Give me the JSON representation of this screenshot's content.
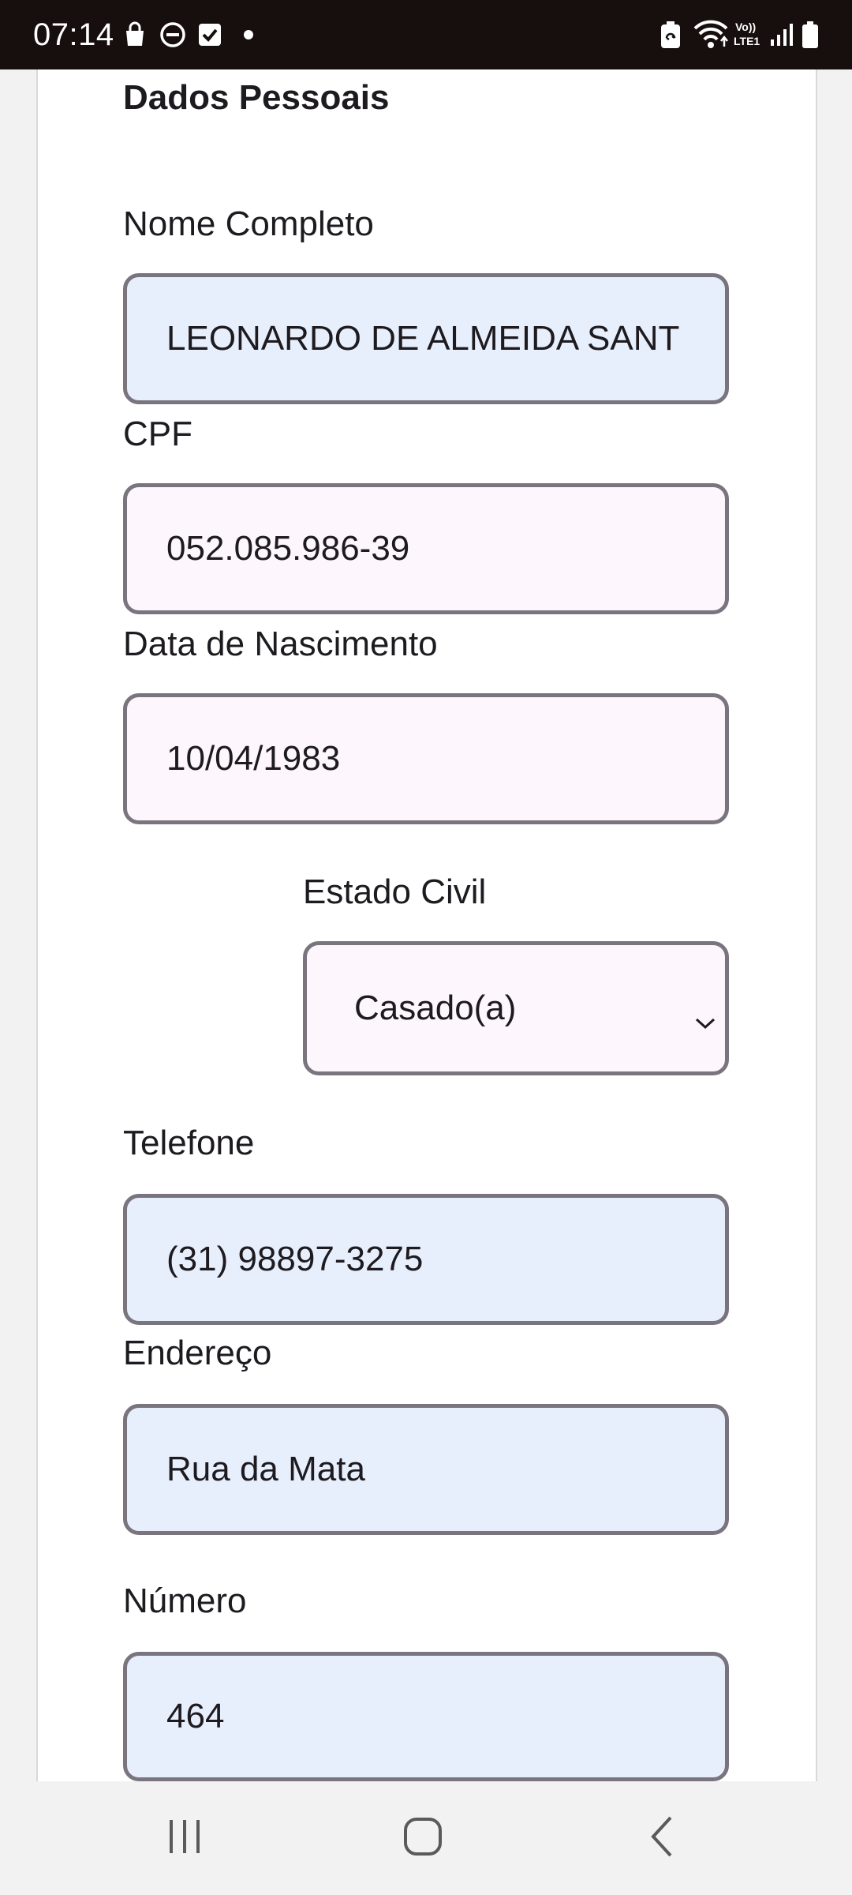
{
  "status_bar": {
    "time": "07:14",
    "left_icons": [
      "shopping-bag-icon",
      "do-not-disturb-icon",
      "checkbox-icon",
      "dot-icon"
    ],
    "right_icons": [
      "battery-saver-icon",
      "wifi-icon",
      "volte-lte-icon",
      "signal-icon",
      "battery-icon"
    ],
    "volte_label": "Vo)) LTE1"
  },
  "form": {
    "section_title": "Dados Pessoais",
    "nome": {
      "label": "Nome Completo",
      "value": "LEONARDO DE ALMEIDA SANT"
    },
    "cpf": {
      "label": "CPF",
      "value": "052.085.986-39"
    },
    "nascimento": {
      "label": "Data de Nascimento",
      "value": "10/04/1983"
    },
    "estado_civil": {
      "label": "Estado Civil",
      "selected": "Casado(a)"
    },
    "telefone": {
      "label": "Telefone",
      "value": "(31) 98897-3275"
    },
    "endereco": {
      "label": "Endereço",
      "value": "Rua da Mata"
    },
    "numero": {
      "label": "Número",
      "value": "464"
    }
  },
  "nav_bar": {
    "buttons": [
      "recent-apps-icon",
      "home-icon",
      "back-icon"
    ]
  },
  "colors": {
    "status_bar_bg": "#170f0d",
    "field_blue_bg": "#e8effc",
    "field_pink_bg": "#fdf6fc",
    "field_border": "#79747e"
  }
}
